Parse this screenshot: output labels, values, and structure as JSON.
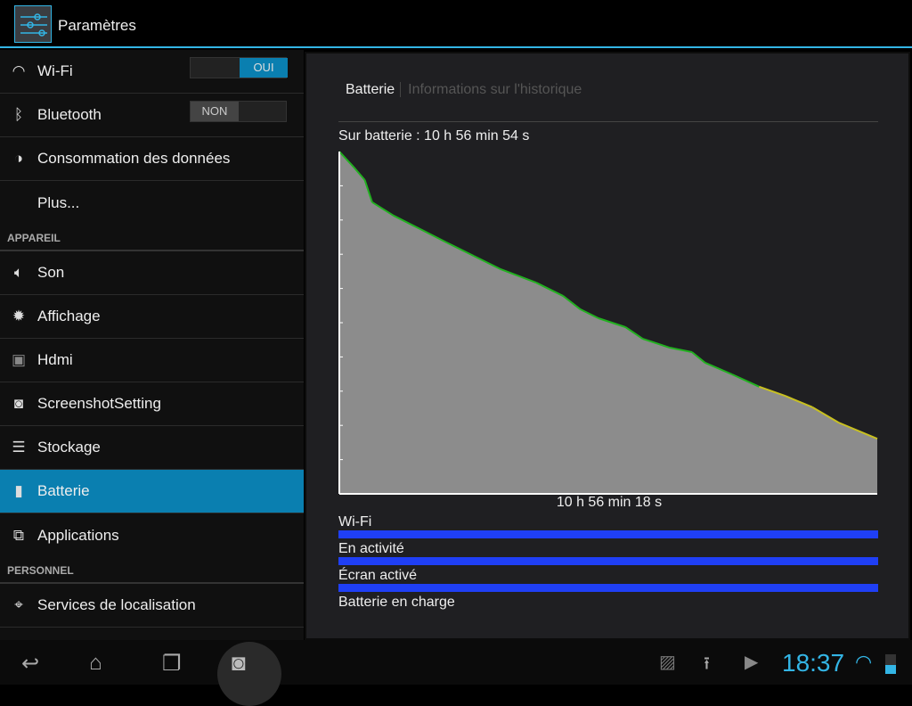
{
  "header": {
    "title": "Paramètres",
    "icon": "settings-sliders-icon"
  },
  "sidebar": {
    "items": [
      {
        "label": "Wi-Fi",
        "icon": "wifi-icon",
        "toggle": "OUI",
        "on": true
      },
      {
        "label": "Bluetooth",
        "icon": "bluetooth-icon",
        "toggle": "NON",
        "on": false
      },
      {
        "label": "Consommation des données",
        "icon": "data-usage-icon"
      },
      {
        "label": "Plus...",
        "icon": ""
      }
    ],
    "section_appareil": "APPAREIL",
    "appareil": [
      {
        "label": "Son",
        "icon": "speaker-icon"
      },
      {
        "label": "Affichage",
        "icon": "brightness-icon"
      },
      {
        "label": "Hdmi",
        "icon": "hdmi-icon"
      },
      {
        "label": "ScreenshotSetting",
        "icon": "camera-icon"
      },
      {
        "label": "Stockage",
        "icon": "storage-icon"
      },
      {
        "label": "Batterie",
        "icon": "battery-icon",
        "selected": true
      },
      {
        "label": "Applications",
        "icon": "applications-icon"
      }
    ],
    "section_personnel": "PERSONNEL",
    "personnel": [
      {
        "label": "Services de localisation",
        "icon": "location-icon"
      }
    ]
  },
  "main": {
    "tabs": [
      {
        "label": "Batterie",
        "active": true
      },
      {
        "label": "Informations sur l'historique",
        "active": false
      }
    ],
    "on_battery": "Sur batterie : 10 h 56 min 54 s",
    "duration": "10 h 56 min 18 s",
    "bars": [
      {
        "label": "Wi-Fi",
        "active": 1
      },
      {
        "label": "En activité",
        "active": 1
      },
      {
        "label": "Écran activé",
        "active": 1
      },
      {
        "label": "Batterie en charge",
        "active": 0
      }
    ],
    "bar_color": "#1f3ff5"
  },
  "chart_data": {
    "type": "area",
    "x_unit": "minutes",
    "y_unit": "percent",
    "ylim": [
      0,
      100
    ],
    "xlim": [
      0,
      656
    ],
    "line_color": "#22b020",
    "low_color": "#c8c020",
    "fill_color": "#8c8c8c",
    "points": [
      [
        0,
        100
      ],
      [
        17,
        95.6
      ],
      [
        31,
        91.7
      ],
      [
        40,
        85.2
      ],
      [
        66,
        81.3
      ],
      [
        99,
        77.3
      ],
      [
        131,
        73.4
      ],
      [
        164,
        69.5
      ],
      [
        197,
        65.6
      ],
      [
        240,
        61.7
      ],
      [
        273,
        57.8
      ],
      [
        294,
        53.9
      ],
      [
        316,
        51.3
      ],
      [
        349,
        48.7
      ],
      [
        370,
        45.3
      ],
      [
        403,
        42.7
      ],
      [
        430,
        41.4
      ],
      [
        446,
        38.3
      ],
      [
        479,
        34.9
      ],
      [
        512,
        31.3
      ],
      [
        544,
        28.6
      ],
      [
        577,
        25.3
      ],
      [
        609,
        20.8
      ],
      [
        656,
        16.1
      ]
    ]
  },
  "statusbar": {
    "time": "18:37",
    "icons": [
      "gallery-icon",
      "upload-icon",
      "play-store-icon",
      "wifi-icon",
      "battery-icon"
    ]
  },
  "navbar": {
    "icons": [
      "back-icon",
      "home-icon",
      "recent-apps-icon",
      "screenshot-camera-icon"
    ]
  }
}
